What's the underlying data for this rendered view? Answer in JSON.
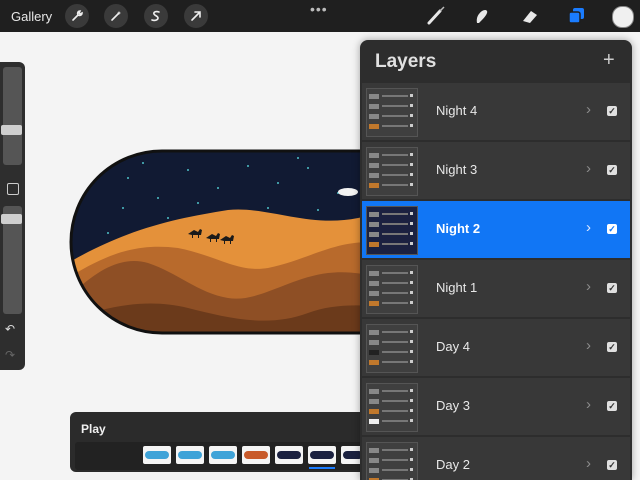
{
  "toolbar": {
    "gallery_label": "Gallery",
    "more_label": "•••",
    "left_tools": [
      "wrench-icon",
      "magic-wand-icon",
      "selection-s-icon",
      "transform-arrow-icon"
    ],
    "right_tools": [
      "brush-icon",
      "smudge-icon",
      "eraser-icon",
      "layers-icon"
    ],
    "active_tool_color": "#1a7cff",
    "current_color": "#f0f0f0"
  },
  "sidebar": {
    "undo_icon": "↶",
    "redo_icon": "↷"
  },
  "play": {
    "label": "Play",
    "frame_count": 8,
    "selected_frame": 6
  },
  "layers_panel": {
    "title": "Layers",
    "add_label": "+",
    "chevron": "›",
    "check": "✓",
    "items": [
      {
        "label": "Night 4",
        "visible": true,
        "active": false
      },
      {
        "label": "Night 3",
        "visible": true,
        "active": false
      },
      {
        "label": "Night 2",
        "visible": true,
        "active": true
      },
      {
        "label": "Night 1",
        "visible": true,
        "active": false
      },
      {
        "label": "Day 4",
        "visible": true,
        "active": false
      },
      {
        "label": "Day 3",
        "visible": true,
        "active": false
      },
      {
        "label": "Day 2",
        "visible": true,
        "active": false
      }
    ],
    "active_color": "#1176f5"
  }
}
